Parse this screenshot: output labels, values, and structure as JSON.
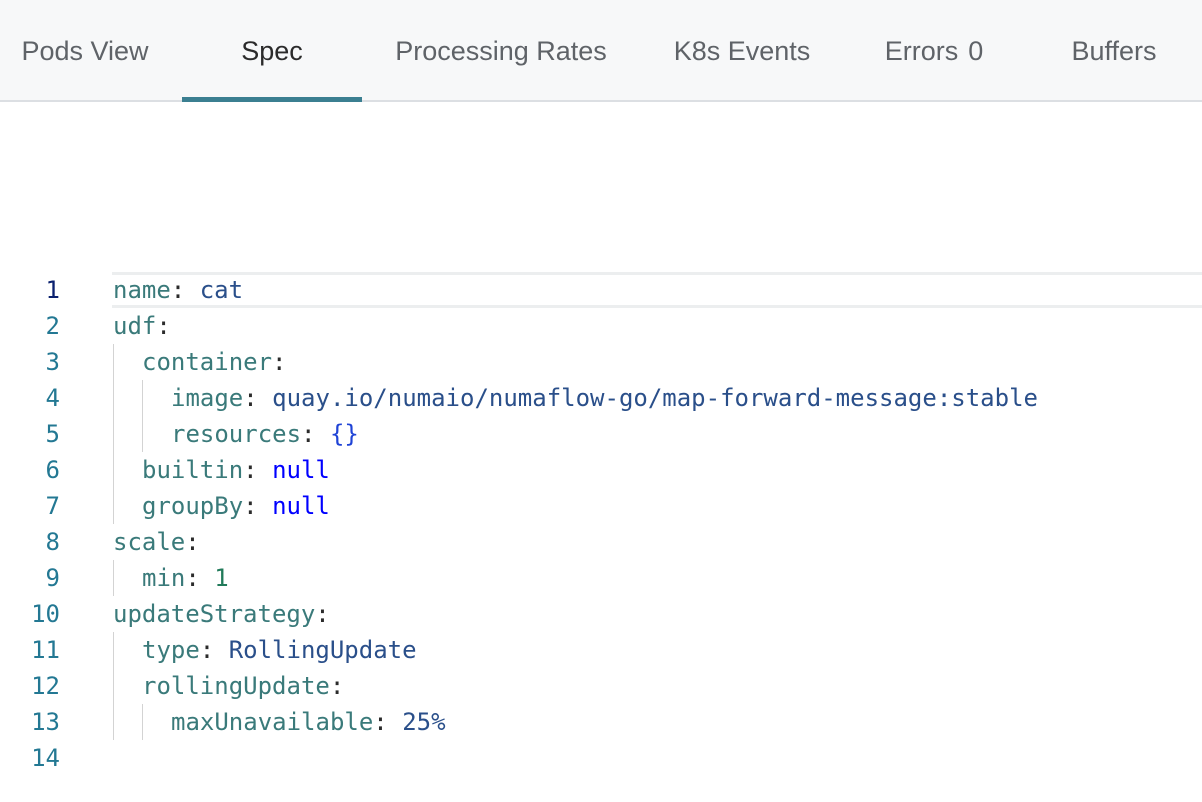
{
  "tabs": [
    {
      "label": "Pods View",
      "active": false
    },
    {
      "label": "Spec",
      "active": true
    },
    {
      "label": "Processing Rates",
      "active": false
    },
    {
      "label": "K8s Events",
      "active": false
    },
    {
      "label": "Errors",
      "count": "0",
      "active": false
    },
    {
      "label": "Buffers",
      "active": false
    }
  ],
  "editor": {
    "current_line": 1,
    "lines": [
      {
        "n": "1",
        "key": "name",
        "value": "cat",
        "value_kind": "string"
      },
      {
        "n": "2",
        "key": "udf",
        "value": "",
        "value_kind": "none"
      },
      {
        "n": "3",
        "key": "container",
        "value": "",
        "value_kind": "none"
      },
      {
        "n": "4",
        "key": "image",
        "value": "quay.io/numaio/numaflow-go/map-forward-message:stable",
        "value_kind": "string"
      },
      {
        "n": "5",
        "key": "resources",
        "value": "{}",
        "value_kind": "brace"
      },
      {
        "n": "6",
        "key": "builtin",
        "value": "null",
        "value_kind": "keyword"
      },
      {
        "n": "7",
        "key": "groupBy",
        "value": "null",
        "value_kind": "keyword"
      },
      {
        "n": "8",
        "key": "scale",
        "value": "",
        "value_kind": "none"
      },
      {
        "n": "9",
        "key": "min",
        "value": "1",
        "value_kind": "number"
      },
      {
        "n": "10",
        "key": "updateStrategy",
        "value": "",
        "value_kind": "none"
      },
      {
        "n": "11",
        "key": "type",
        "value": "RollingUpdate",
        "value_kind": "string"
      },
      {
        "n": "12",
        "key": "rollingUpdate",
        "value": "",
        "value_kind": "none"
      },
      {
        "n": "13",
        "key": "maxUnavailable",
        "value": "25%",
        "value_kind": "string"
      },
      {
        "n": "14",
        "key": "",
        "value": "",
        "value_kind": "none"
      }
    ]
  },
  "colors": {
    "tab_indicator": "#3b7f91",
    "yaml_key": "#3a7a7a",
    "yaml_string": "#2a4f8a",
    "yaml_keyword": "#0000ff",
    "yaml_number": "#217a5a",
    "line_number": "#237893"
  }
}
